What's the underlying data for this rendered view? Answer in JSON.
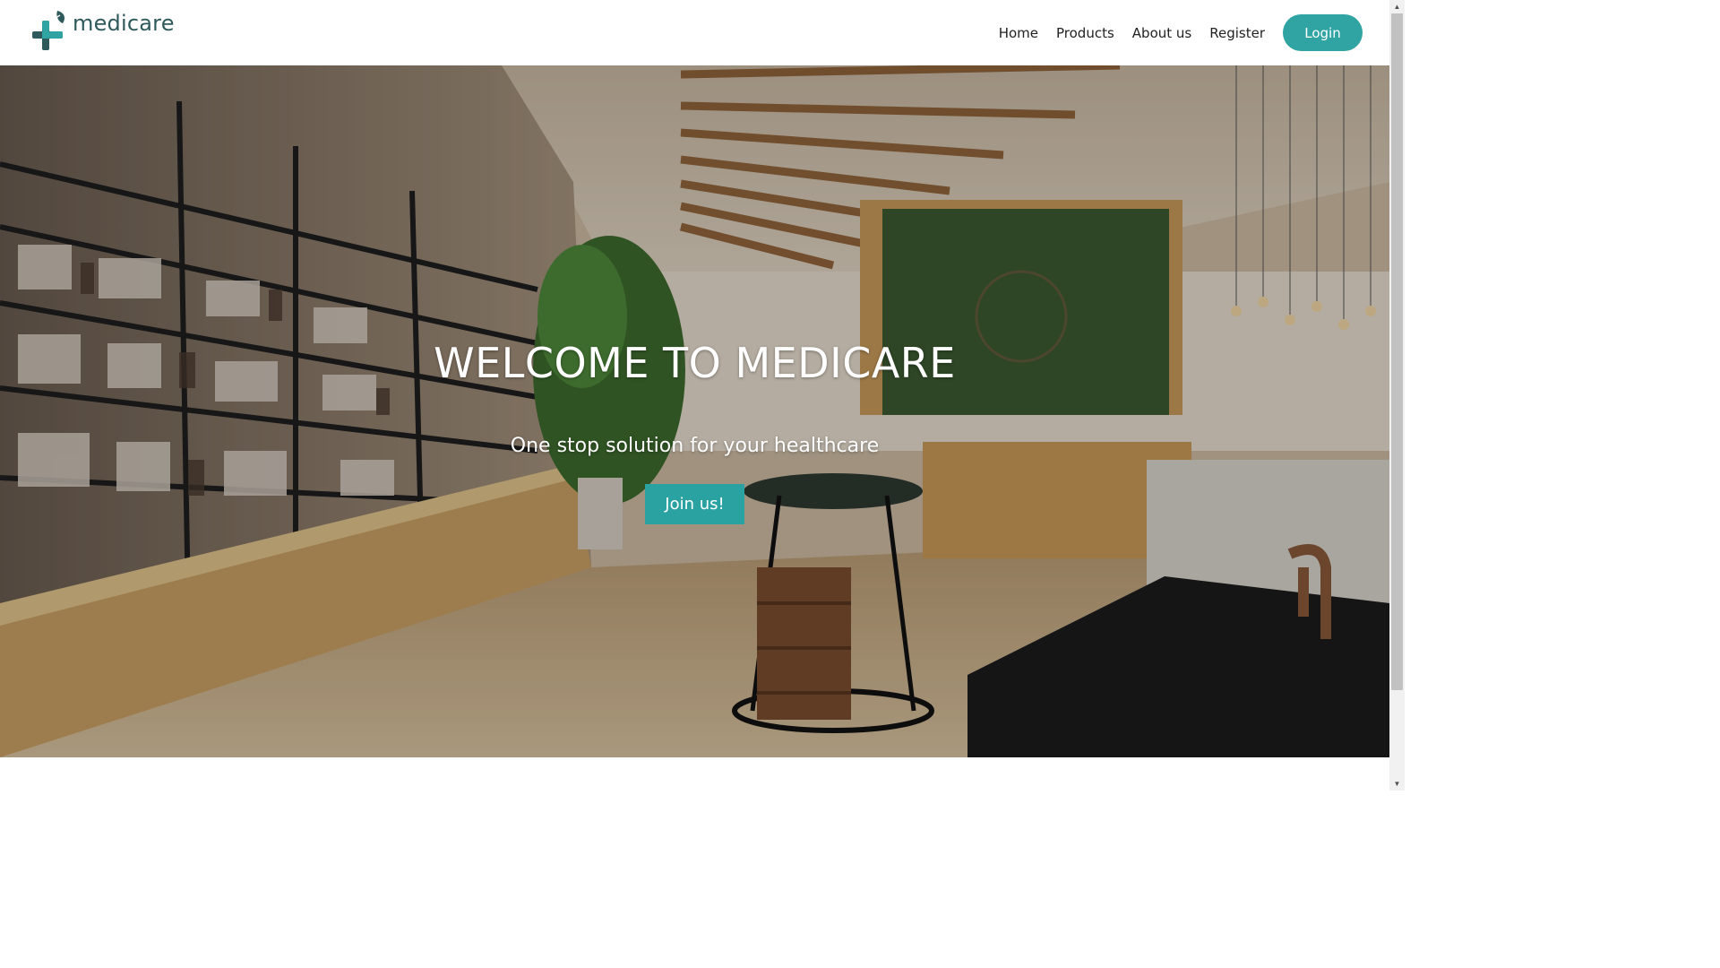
{
  "brand": {
    "name": "medicare",
    "logo_icon": "medical-cross-leaf-icon",
    "colors": {
      "teal": "#30a3a3",
      "dark_teal": "#2f5a5c"
    }
  },
  "nav": {
    "items": [
      {
        "label": "Home"
      },
      {
        "label": "Products"
      },
      {
        "label": "About us"
      },
      {
        "label": "Register"
      }
    ],
    "login_label": "Login"
  },
  "hero": {
    "title": "WELCOME TO MEDICARE",
    "subtitle": "One stop solution for your healthcare",
    "cta_label": "Join us!",
    "background": "pharmacy-store-interior-photo"
  },
  "scrollbar": {
    "up_icon": "scroll-up-arrow-icon",
    "down_icon": "scroll-down-arrow-icon"
  }
}
